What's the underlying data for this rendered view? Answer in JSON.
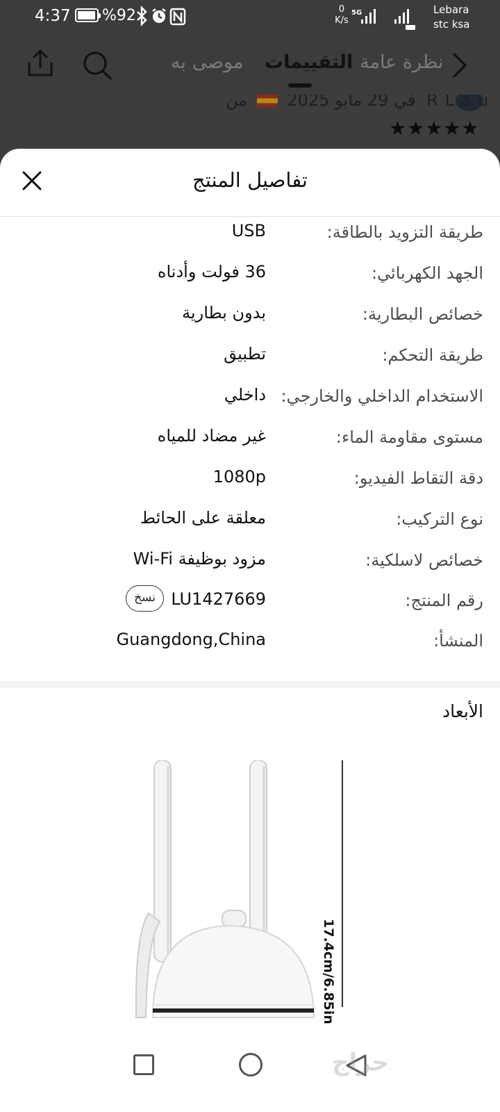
{
  "status_bar": {
    "time": "4:37",
    "battery": "%92",
    "net_speed_value": "0",
    "net_speed_unit": "K/s",
    "network_type": "5G",
    "carrier_1": "Lebara",
    "carrier_2": "stc ksa"
  },
  "top_nav": {
    "tabs": [
      {
        "label": "موصى به"
      },
      {
        "label": "التقييمات"
      },
      {
        "label": "نظرة عامة"
      }
    ],
    "active_tab": "التقييمات"
  },
  "review_peek": {
    "reviewer": "R L a u",
    "from_label": "من",
    "date": "في 29 مايو 2025",
    "stars": "★★★★★",
    "rating": 5
  },
  "sheet": {
    "title": "تفاصيل المنتج",
    "specs": [
      {
        "label": "طريقة التزويد بالطاقة:",
        "value": "USB"
      },
      {
        "label": "الجهد الكهربائي:",
        "value": "36 فولت وأدناه"
      },
      {
        "label": "خصائص البطارية:",
        "value": "بدون بطارية"
      },
      {
        "label": "طريقة التحكم:",
        "value": "تطبيق"
      },
      {
        "label": "الاستخدام الداخلي والخارجي:",
        "value": "داخلي"
      },
      {
        "label": "مستوى مقاومة الماء:",
        "value": "غير مضاد للمياه"
      },
      {
        "label": "دقة التقاط الفيديو:",
        "value": "1080p"
      },
      {
        "label": "نوع التركيب:",
        "value": "معلقة على الحائط"
      },
      {
        "label": "خصائص لاسلكية:",
        "value": "مزود بوظيفة Wi-Fi"
      },
      {
        "label": "رقم المنتج:",
        "value": "LU1427669"
      },
      {
        "label": "المنشأ:",
        "value": "Guangdong,China"
      }
    ],
    "copy_label": "نسخ",
    "dimensions_title": "الأبعاد",
    "dimension_height": "17.4cm/6.85in"
  },
  "watermark": "حراج",
  "colors": {
    "dim_overlay": "#3d3d3d",
    "sheet_bg": "#ffffff",
    "divider": "#f3f3f3"
  }
}
